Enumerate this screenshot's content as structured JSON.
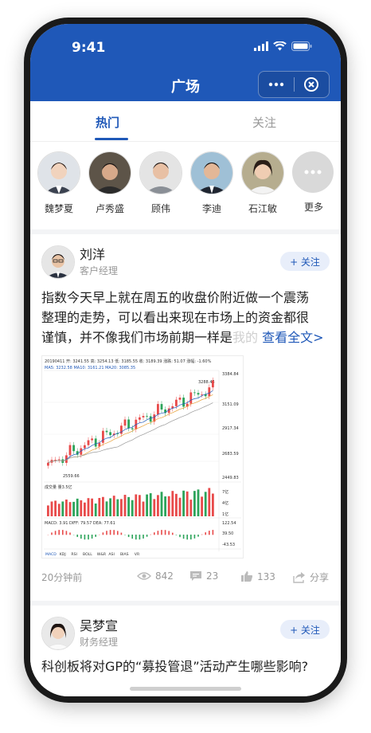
{
  "status_bar": {
    "time": "9:41"
  },
  "nav": {
    "title": "广场"
  },
  "tabs": [
    {
      "label": "热门"
    },
    {
      "label": "关注"
    }
  ],
  "featured_people": [
    {
      "name": "魏梦夏"
    },
    {
      "name": "卢秀盛"
    },
    {
      "name": "顾伟"
    },
    {
      "name": "李迪"
    },
    {
      "name": "石江敏"
    },
    {
      "name": "更多"
    }
  ],
  "posts": [
    {
      "author": "刘洋",
      "role": "客户经理",
      "follow_label": "+ 关注",
      "text_line1": "指数今天早上就在周五的收盘价附近做一个震荡",
      "text_line2": "整理的走势，可以看出来现在市场上的资金都很",
      "text_line3_visible": "谨慎，并不像我们市场前期一样是",
      "text_line3_fade": "我的",
      "read_more": "查看全文>",
      "time": "20分钟前",
      "views": "842",
      "comments": "23",
      "likes": "133",
      "share": "分享"
    },
    {
      "author": "吴梦宣",
      "role": "财务经理",
      "follow_label": "+ 关注",
      "text_line1": "科创板将对GP的“募投管退”活动产生哪些影响?"
    }
  ],
  "chart_data": {
    "type": "candlestick",
    "header": "20190411 开: 3241.55 高: 3254.13 低: 3185.55 收: 3189.39 涨跌: 51.07 涨幅: -1.60%",
    "ma_line": "MA5: 3232.58  MA10: 3161.21  MA20: 3085.35",
    "y_ticks": [
      "3384.84",
      "3151.09",
      "2917.34",
      "2683.59",
      "2449.83"
    ],
    "high_label": "3288.45",
    "low_label": "2559.66",
    "volume_label": "成交量 量3.5亿",
    "volume_ticks": [
      "7亿",
      "4亿",
      "1亿"
    ],
    "macd_line": "MACD: 3.91  DIFF: 79.57  DEA: 77.61",
    "macd_ticks": [
      "122.54",
      "39.50",
      "-43.53"
    ],
    "indicator_tabs": [
      "MACD",
      "KDJ",
      "RSI",
      "BOLL",
      "W&R",
      "ASI",
      "BIAS",
      "VR"
    ],
    "colors": {
      "up": "#e84a4a",
      "down": "#2ca45a",
      "ma5": "#1f58b8",
      "ma10": "#e8a23a",
      "ma20": "#999999"
    }
  },
  "colors": {
    "primary": "#1f58b8",
    "follow_bg": "#e8eefa"
  }
}
